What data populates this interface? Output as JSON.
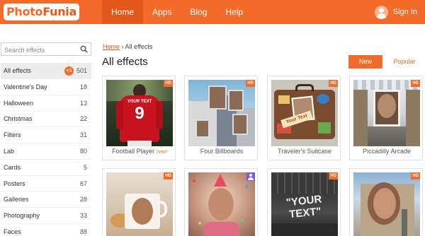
{
  "header": {
    "logo": {
      "part1": "Photo",
      "part2": "Funia"
    },
    "nav": [
      "Home",
      "Apps",
      "Blog",
      "Help"
    ],
    "signin": "Sign In",
    "colors": {
      "brand": "#f26b2a",
      "active": "#e2571a"
    }
  },
  "search": {
    "placeholder": "Search effects",
    "icon": "search-icon"
  },
  "sidebar": {
    "categories": [
      {
        "label": "All effects",
        "count": "501",
        "badge": "+1"
      },
      {
        "label": "Valentine's Day",
        "count": "18"
      },
      {
        "label": "Halloween",
        "count": "13"
      },
      {
        "label": "Christmas",
        "count": "22"
      },
      {
        "label": "Filters",
        "count": "31"
      },
      {
        "label": "Lab",
        "count": "80"
      },
      {
        "label": "Cards",
        "count": "5"
      },
      {
        "label": "Posters",
        "count": "67"
      },
      {
        "label": "Galleries",
        "count": "28"
      },
      {
        "label": "Photography",
        "count": "33"
      },
      {
        "label": "Faces",
        "count": "88"
      }
    ]
  },
  "main": {
    "breadcrumb": {
      "home": "Home",
      "separator": "›",
      "current": "All effects"
    },
    "title": "All effects",
    "sort": {
      "new": "New",
      "popular": "Popular"
    },
    "cards": [
      {
        "label": "Football Player",
        "badge": "HD",
        "tag": "new!",
        "jersey_text": "YOUR TEXT",
        "jersey_number": "9"
      },
      {
        "label": "Four Billboards",
        "badge": "HD"
      },
      {
        "label": "Traveler's Suitcase",
        "badge": "HD",
        "sticker_text": "Your Text"
      },
      {
        "label": "Piccadilly Arcade",
        "badge": "HD"
      },
      {
        "label": "",
        "badge": "HD"
      },
      {
        "label": "",
        "badge": ""
      },
      {
        "label": "",
        "badge": "HD",
        "sign_text": "\"YOUR TEXT\""
      },
      {
        "label": "",
        "badge": "HD"
      }
    ]
  }
}
